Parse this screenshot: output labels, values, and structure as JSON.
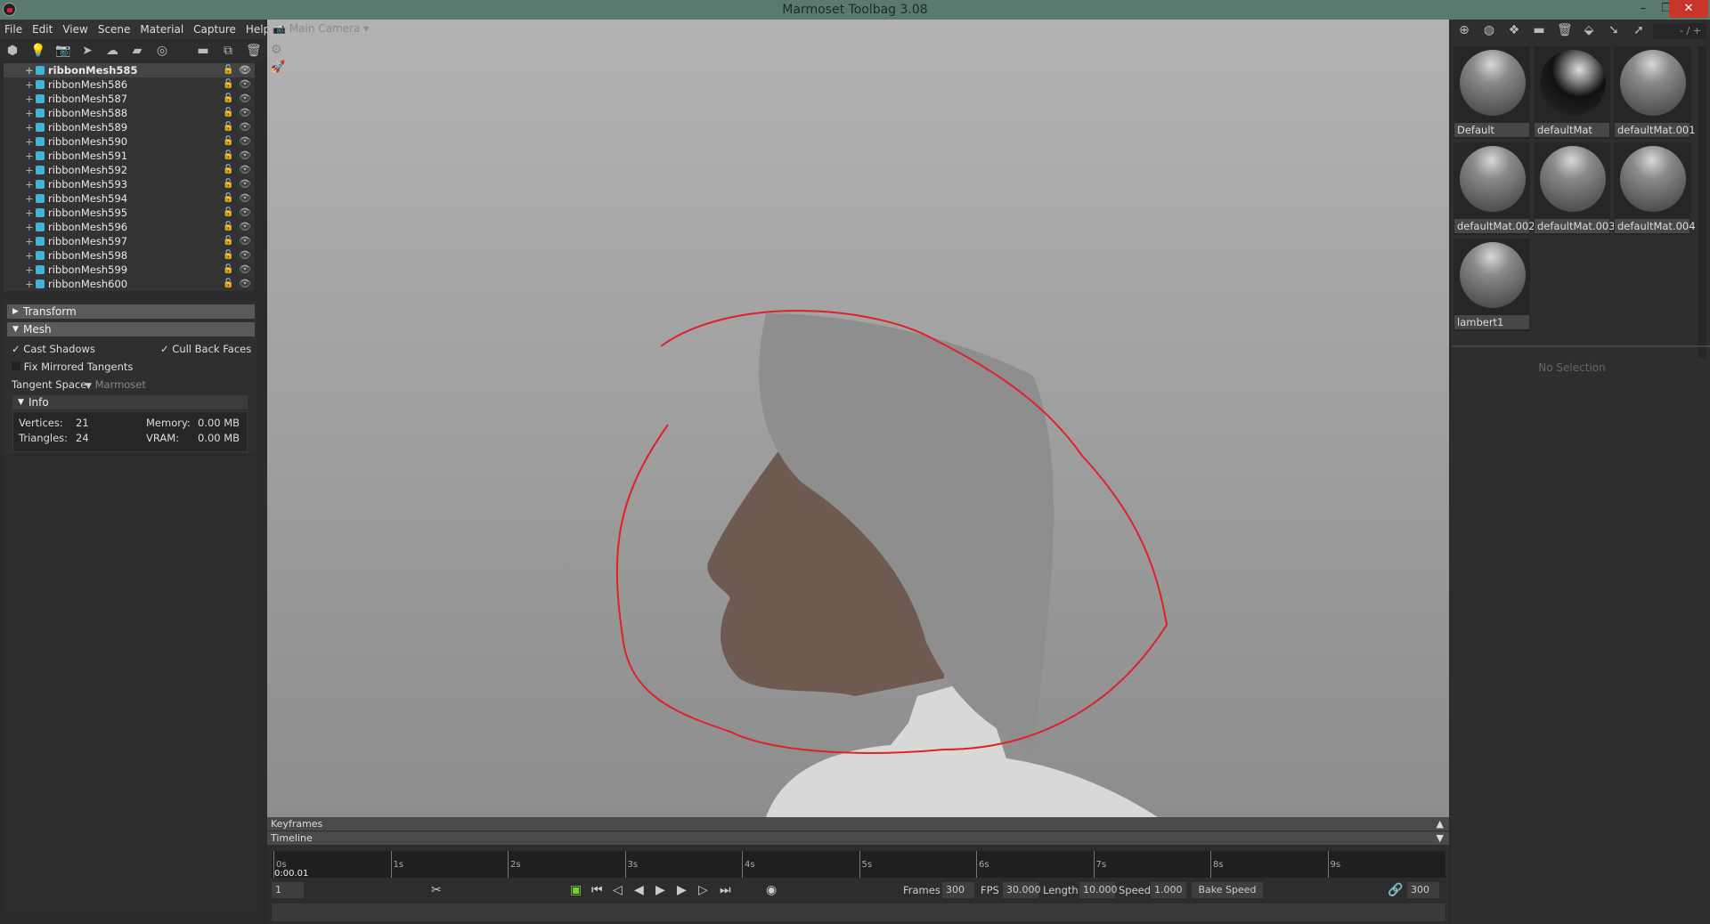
{
  "window": {
    "title": "Marmoset Toolbag 3.08"
  },
  "menu": [
    "File",
    "Edit",
    "View",
    "Scene",
    "Material",
    "Capture",
    "Help"
  ],
  "outliner": {
    "items": [
      "ribbonMesh585",
      "ribbonMesh586",
      "ribbonMesh587",
      "ribbonMesh588",
      "ribbonMesh589",
      "ribbonMesh590",
      "ribbonMesh591",
      "ribbonMesh592",
      "ribbonMesh593",
      "ribbonMesh594",
      "ribbonMesh595",
      "ribbonMesh596",
      "ribbonMesh597",
      "ribbonMesh598",
      "ribbonMesh599",
      "ribbonMesh600"
    ],
    "selected": "ribbonMesh585"
  },
  "properties": {
    "transform": "Transform",
    "mesh": "Mesh",
    "cast_shadows": "Cast Shadows",
    "cull_back_faces": "Cull Back Faces",
    "fix_mirrored": "Fix Mirrored Tangents",
    "tangent_space_label": "Tangent Space",
    "tangent_space_value": "Marmoset",
    "info": "Info",
    "vertices_label": "Vertices:",
    "vertices": "21",
    "triangles_label": "Triangles:",
    "triangles": "24",
    "memory_label": "Memory:",
    "memory": "0.00 MB",
    "vram_label": "VRAM:",
    "vram": "0.00 MB"
  },
  "viewport": {
    "camera": "Main Camera",
    "lasso_color": "#e0202a"
  },
  "timeline": {
    "keyframes": "Keyframes",
    "timeline": "Timeline",
    "ticks": [
      "0s",
      "1s",
      "2s",
      "3s",
      "4s",
      "5s",
      "6s",
      "7s",
      "8s",
      "9s"
    ],
    "current_time": "0:00.01",
    "frame": "1",
    "frames_label": "Frames",
    "frames": "300",
    "fps_label": "FPS",
    "fps": "30.000",
    "length_label": "Length",
    "length": "10.000",
    "speed_label": "Speed",
    "speed": "1.000",
    "bake_speed": "Bake Speed",
    "end_frame": "300"
  },
  "materials": {
    "items": [
      "Default",
      "defaultMat",
      "defaultMat.001",
      "defaultMat.002",
      "defaultMat.003",
      "defaultMat.004",
      "lambert1"
    ],
    "page": "- / +",
    "no_selection": "No Selection"
  }
}
